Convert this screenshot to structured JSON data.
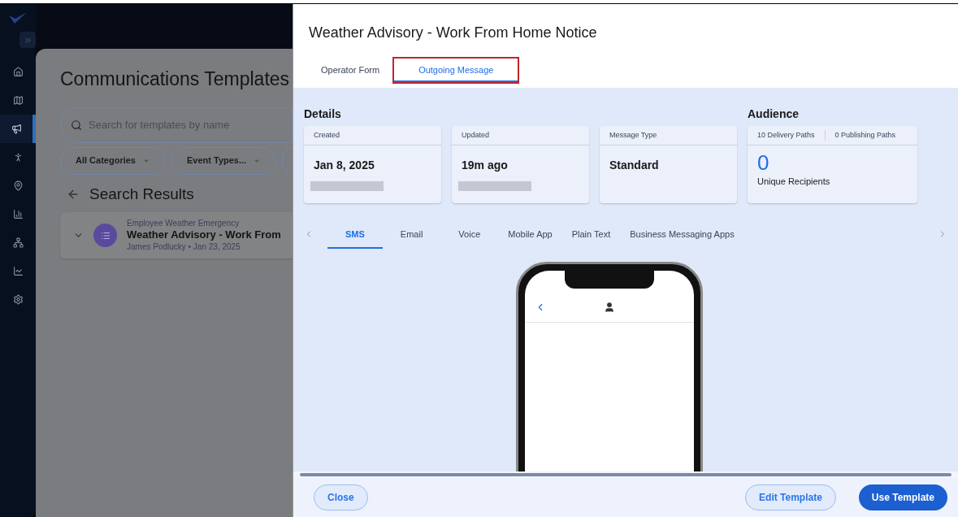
{
  "nav": [
    {
      "selected": false
    },
    {
      "selected": false
    },
    {
      "selected": true
    },
    {
      "selected": false
    },
    {
      "selected": false
    },
    {
      "selected": false
    },
    {
      "selected": false
    },
    {
      "selected": false
    },
    {
      "selected": false
    }
  ],
  "page": {
    "title": "Communications Templates",
    "search": {
      "placeholder": "Search for templates by name"
    },
    "filters": [
      "All Categories",
      "Event Types..."
    ],
    "section": "Search Results",
    "result": {
      "category": "Employee Weather Emergency",
      "title": "Weather Advisory - Work From",
      "meta": "James Podlucky • Jan 23, 2025",
      "expanded": false
    }
  },
  "drawer": {
    "title": "Weather Advisory - Work From Home Notice",
    "tabs": [
      {
        "label": "Operator Form",
        "selected": false,
        "highlighted": false
      },
      {
        "label": "Outgoing Message",
        "selected": true,
        "highlighted": true
      }
    ],
    "details": {
      "heading": "Details",
      "cards": [
        {
          "label": "Created",
          "value": "Jan 8, 2025",
          "redacted": true
        },
        {
          "label": "Updated",
          "value": "19m ago",
          "redacted": true
        },
        {
          "label": "Message Type",
          "value": "Standard",
          "redacted": false
        }
      ]
    },
    "audience": {
      "heading": "Audience",
      "paths": [
        "10 Delivery Paths",
        "0 Publishing Paths"
      ],
      "count": "0",
      "count_label": "Unique Recipients"
    },
    "channel_tabs": [
      {
        "label": "SMS",
        "selected": true
      },
      {
        "label": "Email",
        "selected": false
      },
      {
        "label": "Voice",
        "selected": false
      },
      {
        "label": "Mobile App",
        "selected": false
      },
      {
        "label": "Plain Text",
        "selected": false
      },
      {
        "label": "Business Messaging Apps",
        "selected": false
      }
    ],
    "buttons": [
      {
        "label": "Close",
        "kind": "outline"
      },
      {
        "label": "Edit Template",
        "kind": "outline"
      },
      {
        "label": "Use Template",
        "kind": "primary"
      }
    ]
  }
}
